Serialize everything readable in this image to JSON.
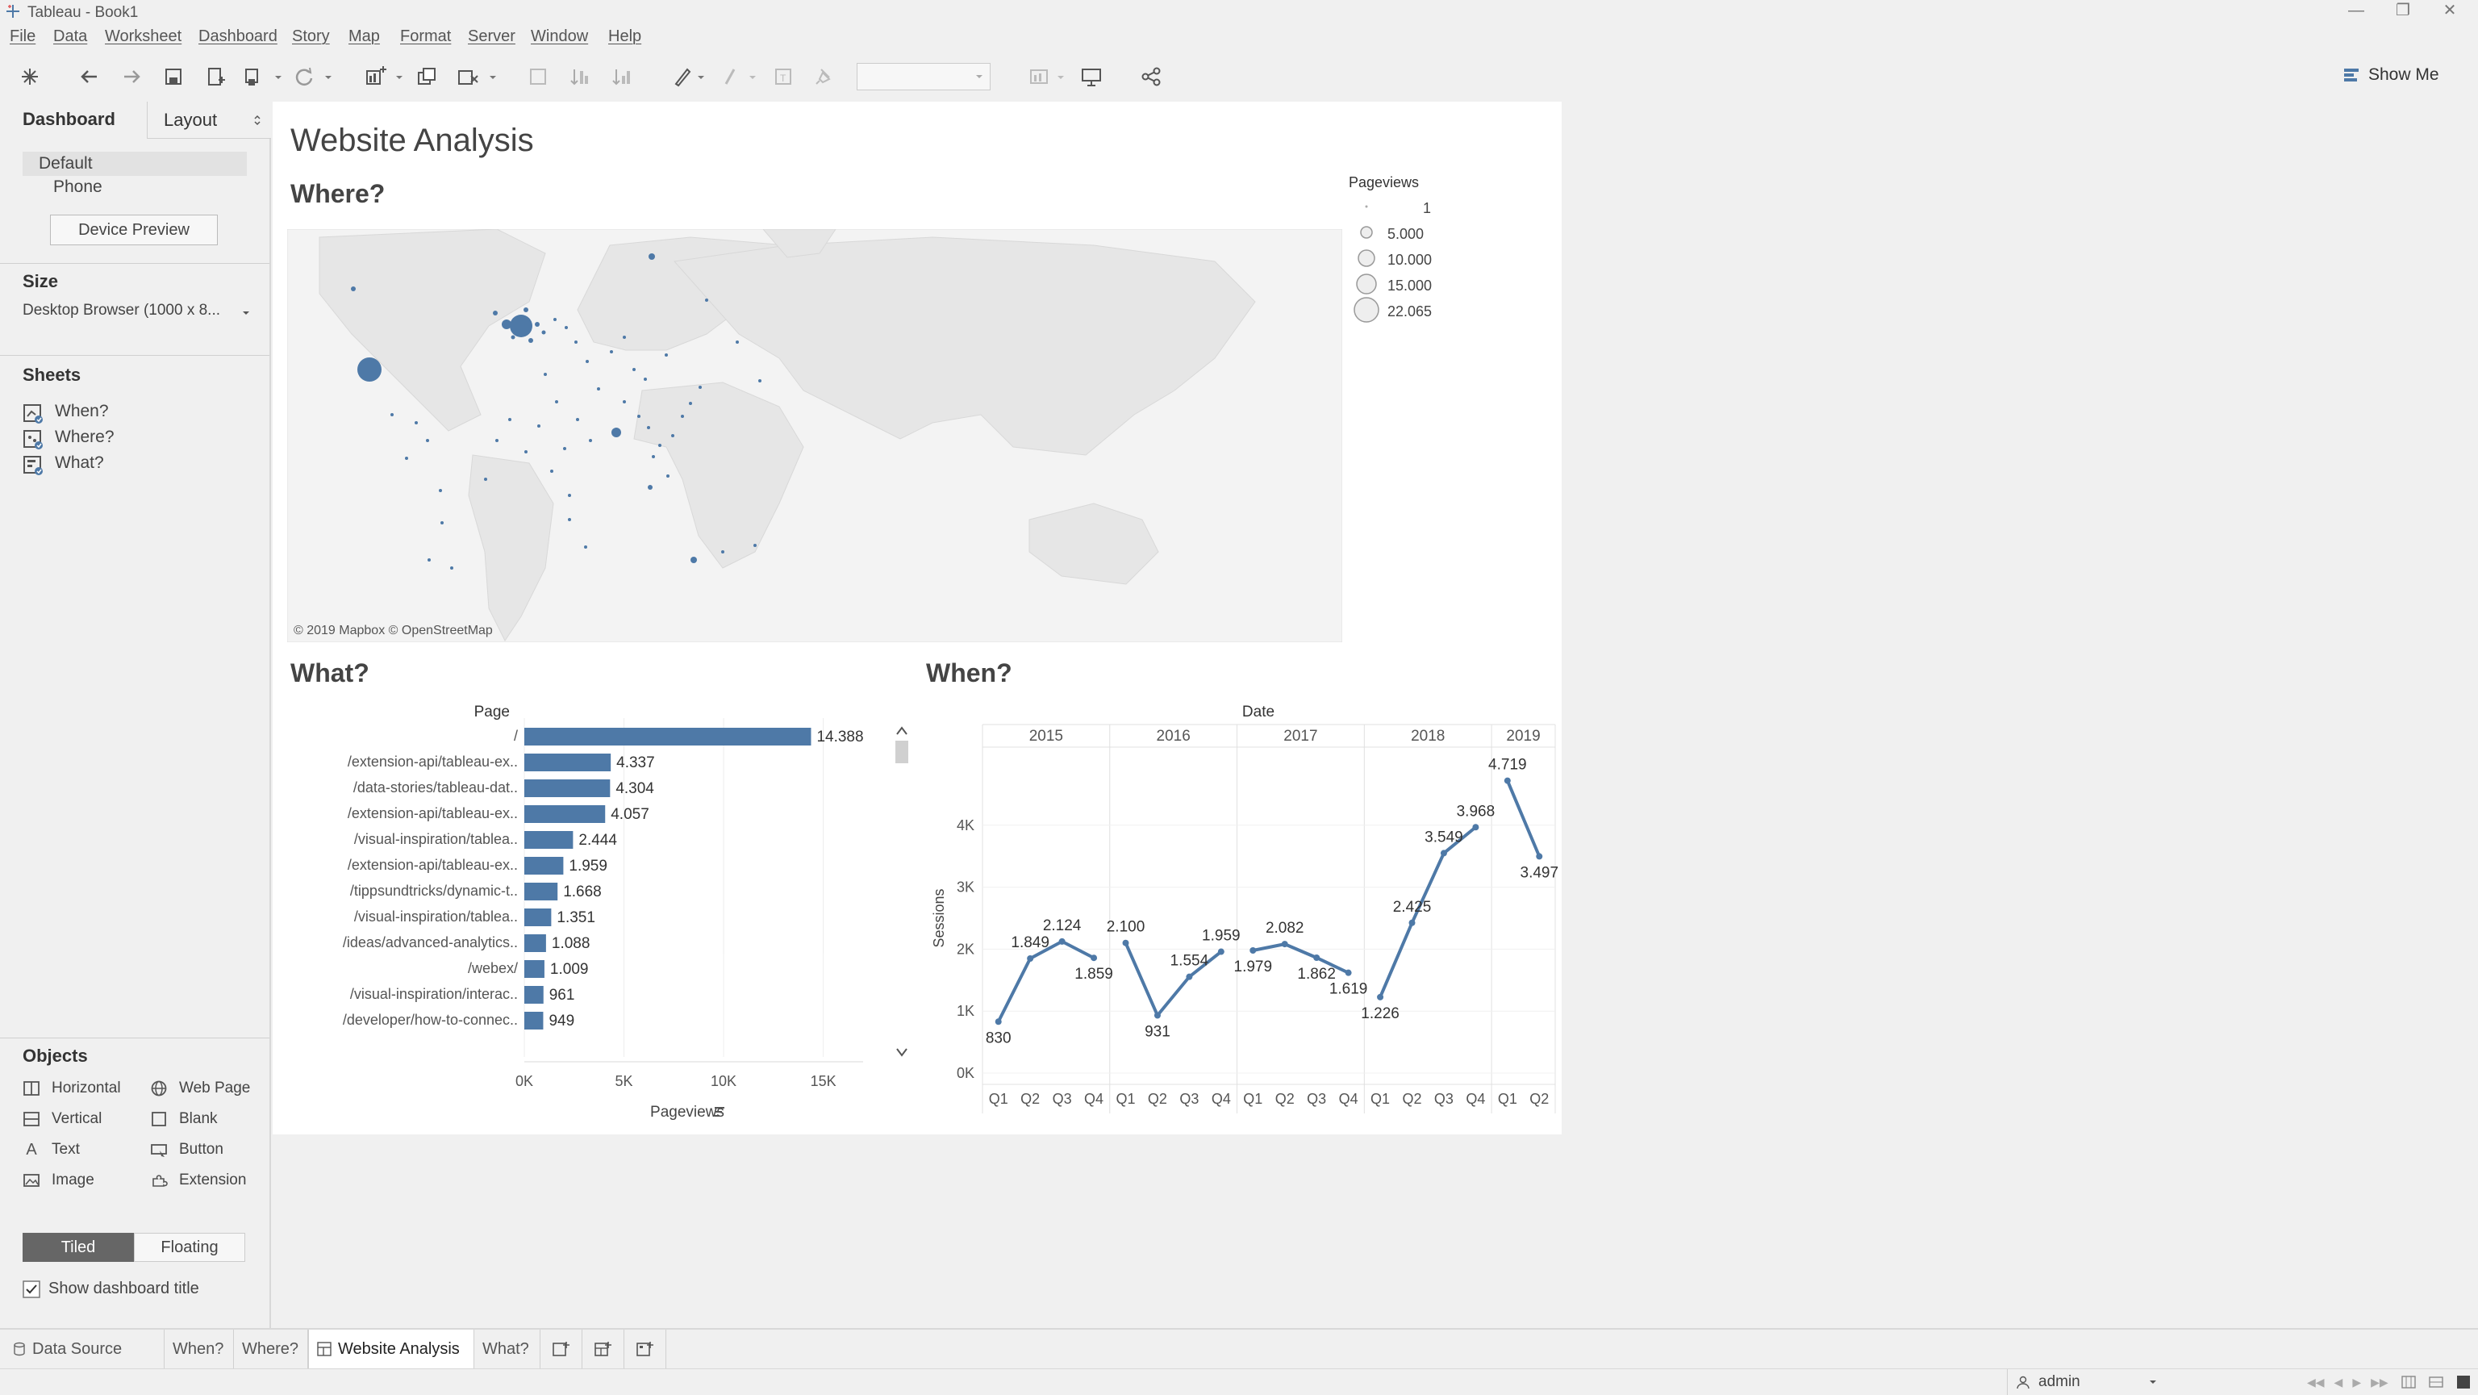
{
  "window": {
    "title": "Tableau - Book1"
  },
  "menu": [
    "File",
    "Data",
    "Worksheet",
    "Dashboard",
    "Story",
    "Map",
    "Format",
    "Server",
    "Window",
    "Help"
  ],
  "toolbar": {
    "show_me": "Show Me"
  },
  "left_pane": {
    "tab_dashboard": "Dashboard",
    "tab_layout": "Layout",
    "devices": [
      "Default",
      "Phone"
    ],
    "device_preview_button": "Device Preview",
    "size_title": "Size",
    "size_value": "Desktop Browser (1000 x 8...",
    "sheets_title": "Sheets",
    "sheets": [
      "When?",
      "Where?",
      "What?"
    ],
    "objects_title": "Objects",
    "objects": [
      {
        "label": "Horizontal",
        "icon": "horizontal-container-icon"
      },
      {
        "label": "Web Page",
        "icon": "globe-icon"
      },
      {
        "label": "Vertical",
        "icon": "vertical-container-icon"
      },
      {
        "label": "Blank",
        "icon": "blank-icon"
      },
      {
        "label": "Text",
        "icon": "text-icon"
      },
      {
        "label": "Button",
        "icon": "button-icon"
      },
      {
        "label": "Image",
        "icon": "image-icon"
      },
      {
        "label": "Extension",
        "icon": "extension-icon"
      }
    ],
    "tiled_label": "Tiled",
    "floating_label": "Floating",
    "show_title_label": "Show dashboard title"
  },
  "dashboard": {
    "title": "Website Analysis",
    "where_title": "Where?",
    "what_title": "What?",
    "when_title": "When?",
    "map_attribution": "© 2019 Mapbox © OpenStreetMap",
    "legend": {
      "title": "Pageviews",
      "items": [
        "1",
        "5.000",
        "10.000",
        "15.000",
        "22.065"
      ]
    }
  },
  "chart_data": [
    {
      "type": "bar",
      "orientation": "horizontal",
      "title": "What?",
      "ylabel": "Page",
      "xlabel": "Pageviews",
      "categories": [
        "/",
        "/extension-api/tableau-ex..",
        "/data-stories/tableau-dat..",
        "/extension-api/tableau-ex..",
        "/visual-inspiration/tablea..",
        "/extension-api/tableau-ex..",
        "/tippsundtricks/dynamic-t..",
        "/visual-inspiration/tablea..",
        "/ideas/advanced-analytics..",
        "/webex/",
        "/visual-inspiration/interac..",
        "/developer/how-to-connec.."
      ],
      "values": [
        14388,
        4337,
        4304,
        4057,
        2444,
        1959,
        1668,
        1351,
        1088,
        1009,
        961,
        949
      ],
      "value_labels": [
        "14.388",
        "4.337",
        "4.304",
        "4.057",
        "2.444",
        "1.959",
        "1.668",
        "1.351",
        "1.088",
        "1.009",
        "961",
        "949"
      ],
      "xticks": [
        "0K",
        "5K",
        "10K",
        "15K"
      ],
      "xlim": [
        0,
        17000
      ],
      "color": "#4e79a7"
    },
    {
      "type": "line",
      "title": "When?",
      "xlabel": "Date",
      "ylabel": "Sessions",
      "years": [
        "2015",
        "2016",
        "2017",
        "2018",
        "2019"
      ],
      "quarters": [
        "Q1",
        "Q2",
        "Q3",
        "Q4",
        "Q1",
        "Q2",
        "Q3",
        "Q4",
        "Q1",
        "Q2",
        "Q3",
        "Q4",
        "Q1",
        "Q2",
        "Q3",
        "Q4",
        "Q1",
        "Q2"
      ],
      "values": [
        830,
        1849,
        2124,
        1859,
        2100,
        931,
        1554,
        1959,
        1979,
        2082,
        1862,
        1619,
        1226,
        2425,
        3549,
        3968,
        4719,
        3497
      ],
      "value_labels": [
        "830",
        "1.849",
        "2.124",
        "1.859",
        "2.100",
        "931",
        "1.554",
        "1.959",
        "1.979",
        "2.082",
        "1.862",
        "1.619",
        "1.226",
        "2.425",
        "3.549",
        "3.968",
        "4.719",
        "3.497"
      ],
      "yticks": [
        "0K",
        "1K",
        "2K",
        "3K",
        "4K"
      ],
      "ylim": [
        0,
        5000
      ],
      "color": "#4e79a7"
    }
  ],
  "sheet_tabs": {
    "data_source": "Data Source",
    "tabs": [
      "When?",
      "Where?",
      "Website Analysis",
      "What?"
    ]
  },
  "status": {
    "user": "admin"
  }
}
